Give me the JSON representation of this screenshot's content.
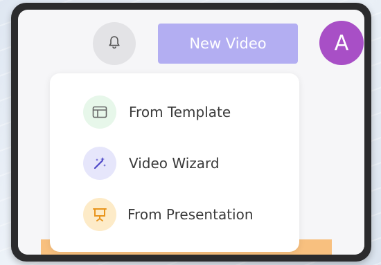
{
  "header": {
    "notification_icon": "bell-icon",
    "new_video_label": "New Video",
    "avatar_initial": "A"
  },
  "colors": {
    "new_video_bg": "#b3aef2",
    "avatar_bg": "#a84fc6",
    "template_icon_bg": "#e7f7ea",
    "wizard_icon_bg": "#e6e6fb",
    "presentation_icon_bg": "#fdebc8",
    "accent_orange": "#f0a030"
  },
  "menu": {
    "items": [
      {
        "label": "From Template",
        "icon": "template-icon"
      },
      {
        "label": "Video Wizard",
        "icon": "magic-wand-icon"
      },
      {
        "label": "From Presentation",
        "icon": "presentation-icon"
      }
    ]
  }
}
